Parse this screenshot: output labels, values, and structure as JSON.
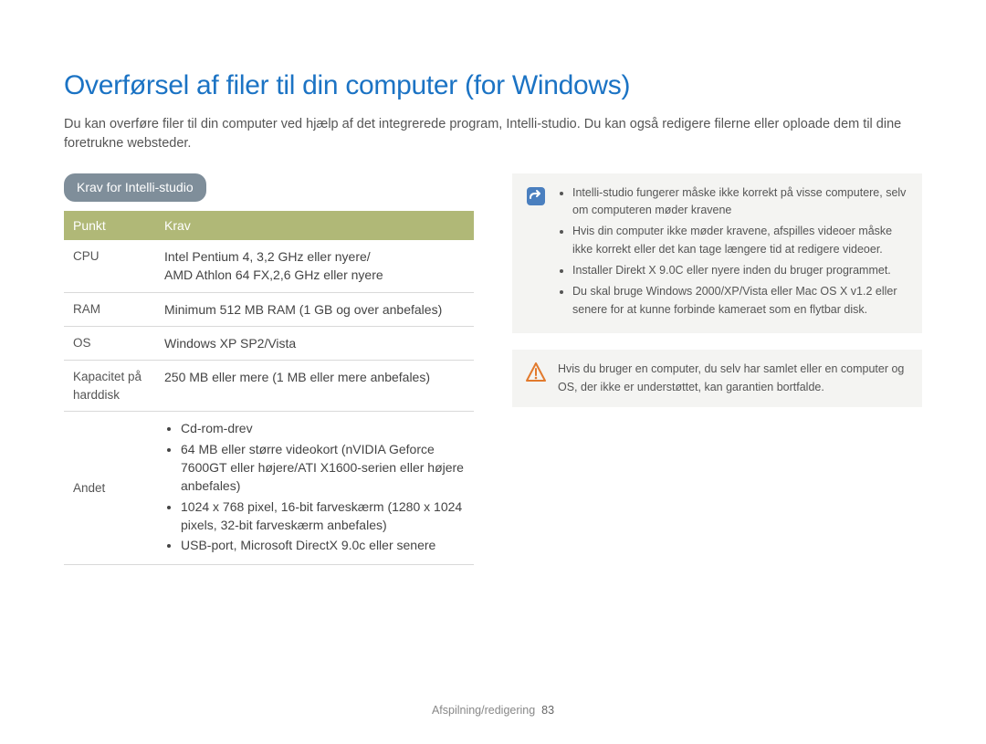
{
  "title": "Overførsel af filer til din computer (for Windows)",
  "intro": "Du kan overføre filer til din computer ved hjælp af det integrerede program, Intelli-studio. Du kan også redigere filerne eller oploade dem til dine foretrukne websteder.",
  "section_heading": "Krav for Intelli-studio",
  "table": {
    "head_left": "Punkt",
    "head_right": "Krav",
    "rows": {
      "cpu_label": "CPU",
      "cpu_value": "Intel Pentium 4, 3,2 GHz eller nyere/\nAMD Athlon 64 FX,2,6 GHz eller nyere",
      "ram_label": "RAM",
      "ram_value": "Minimum 512 MB RAM (1 GB og over anbefales)",
      "os_label": "OS",
      "os_value": "Windows XP SP2/Vista",
      "disk_label": "Kapacitet på harddisk",
      "disk_value": "250 MB eller mere (1 MB eller mere anbefales)",
      "other_label": "Andet",
      "other_items": {
        "i0": "Cd-rom-drev",
        "i1": "64 MB eller større videokort (nVIDIA Geforce 7600GT eller højere/ATI X1600-serien eller højere anbefales)",
        "i2": "1024 x 768 pixel, 16-bit farveskærm (1280 x 1024 pixels, 32-bit farveskærm anbefales)",
        "i3": "USB-port, Microsoft DirectX 9.0c eller senere"
      }
    }
  },
  "note": {
    "items": {
      "n0": "Intelli-studio fungerer måske ikke korrekt på visse computere, selv om computeren møder kravene",
      "n1": "Hvis din computer ikke møder kravene, afspilles videoer måske ikke korrekt eller det kan tage længere tid at redigere videoer.",
      "n2": "Installer Direkt X 9.0C eller nyere inden du bruger programmet.",
      "n3": "Du skal bruge Windows 2000/XP/Vista eller Mac OS X v1.2 eller senere for at kunne forbinde kameraet som en flytbar disk."
    }
  },
  "warning": "Hvis du bruger en computer, du selv har samlet eller en computer og OS, der ikke er understøttet, kan garantien bortfalde.",
  "footer_section": "Afspilning/redigering",
  "footer_page": "83"
}
